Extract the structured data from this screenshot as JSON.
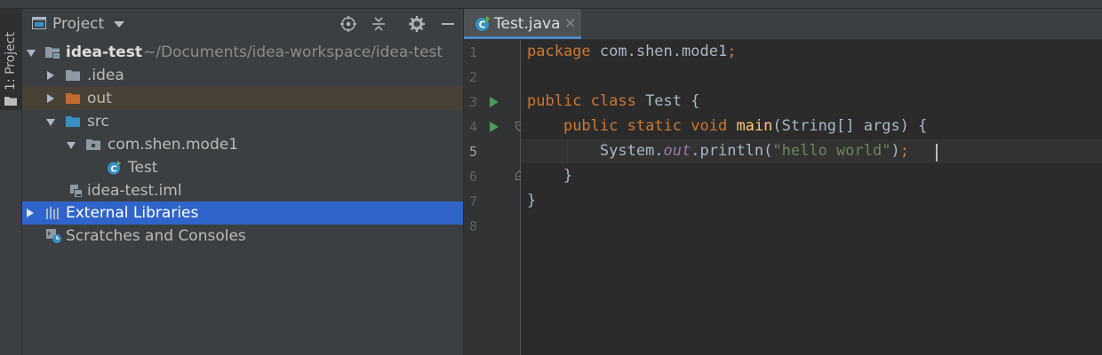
{
  "side_panel": {
    "tab_label": "1: Project",
    "folder_icon": "folder-icon"
  },
  "project_panel": {
    "title": "Project",
    "toolbar": [
      "crosshair-icon",
      "collapse-icon",
      "gear-icon",
      "minimize-icon"
    ],
    "tree": [
      {
        "label": "idea-test",
        "path": "~/Documents/idea-workspace/idea-test",
        "bold": true,
        "expanded": true,
        "icon": "module-folder-icon"
      },
      {
        "label": ".idea",
        "expanded": false,
        "icon": "folder-icon"
      },
      {
        "label": "out",
        "expanded": false,
        "icon": "excluded-folder-icon"
      },
      {
        "label": "src",
        "expanded": true,
        "icon": "source-folder-icon"
      },
      {
        "label": "com.shen.mode1",
        "expanded": true,
        "icon": "package-icon"
      },
      {
        "label": "Test",
        "icon": "java-class-icon"
      },
      {
        "label": "idea-test.iml",
        "icon": "iml-file-icon"
      },
      {
        "label": "External Libraries",
        "expanded": false,
        "selected": true,
        "icon": "libraries-icon"
      },
      {
        "label": "Scratches and Consoles",
        "icon": "scratches-icon"
      }
    ]
  },
  "editor": {
    "tab": {
      "label": "Test.java",
      "close": "×",
      "icon": "java-class-icon"
    },
    "line_numbers": [
      "1",
      "2",
      "3",
      "4",
      "5",
      "6",
      "7",
      "8"
    ],
    "current_line": 5,
    "code": {
      "l1": {
        "kw": "package",
        "rest": " com.shen.mode1",
        "semi": ";"
      },
      "l3": {
        "kw": "public class",
        "rest": " Test {"
      },
      "l4": {
        "kw": "public static void",
        "fn": "main",
        "rest": "(String[] args) {"
      },
      "l5": {
        "a": "System.",
        "stat": "out",
        "b": ".println(",
        "str": "\"hello world\"",
        "c": ")",
        "semi": ";"
      },
      "l6": {
        "rest": "}"
      },
      "l7": {
        "rest": "}"
      }
    }
  },
  "colors": {
    "keyword": "#cc7832",
    "function": "#ffc66d",
    "string": "#6a8759",
    "static_field": "#9876aa",
    "selection": "#2f65ca",
    "run_icon": "#499c54"
  }
}
